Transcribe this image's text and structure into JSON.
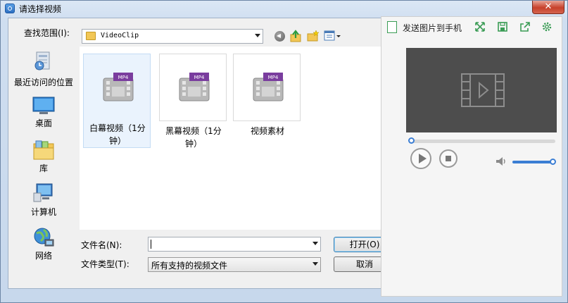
{
  "window": {
    "title": "请选择视频",
    "close_glyph": "✕"
  },
  "dialog": {
    "lookin_label": "查找范围(I):",
    "lookin_value": "VideoClip",
    "places": [
      {
        "label": "最近访问的位置",
        "icon": "recent-places-icon"
      },
      {
        "label": "桌面",
        "icon": "desktop-icon"
      },
      {
        "label": "库",
        "icon": "libraries-icon"
      },
      {
        "label": "计算机",
        "icon": "computer-icon"
      },
      {
        "label": "网络",
        "icon": "network-icon"
      }
    ],
    "items": [
      {
        "name": "白幕视频（1分钟）",
        "badge": "MP4",
        "selected": true
      },
      {
        "name": "黑幕视频（1分钟）",
        "badge": "MP4",
        "selected": false
      },
      {
        "name": "视频素材",
        "badge": "MP4",
        "selected": false
      }
    ],
    "filename_label": "文件名(N):",
    "filename_value": "",
    "filetype_label": "文件类型(T):",
    "filetype_value": "所有支持的视频文件",
    "open_label": "打开(O)",
    "cancel_label": "取消"
  },
  "preview": {
    "send_label": "发送图片到手机",
    "seek_progress": 0,
    "volume_level": 0.95
  },
  "colors": {
    "accent": "#3b7ed4",
    "screen": "#4d4d4d",
    "green_icons": "#3a9c55",
    "close": "#c7402a"
  }
}
